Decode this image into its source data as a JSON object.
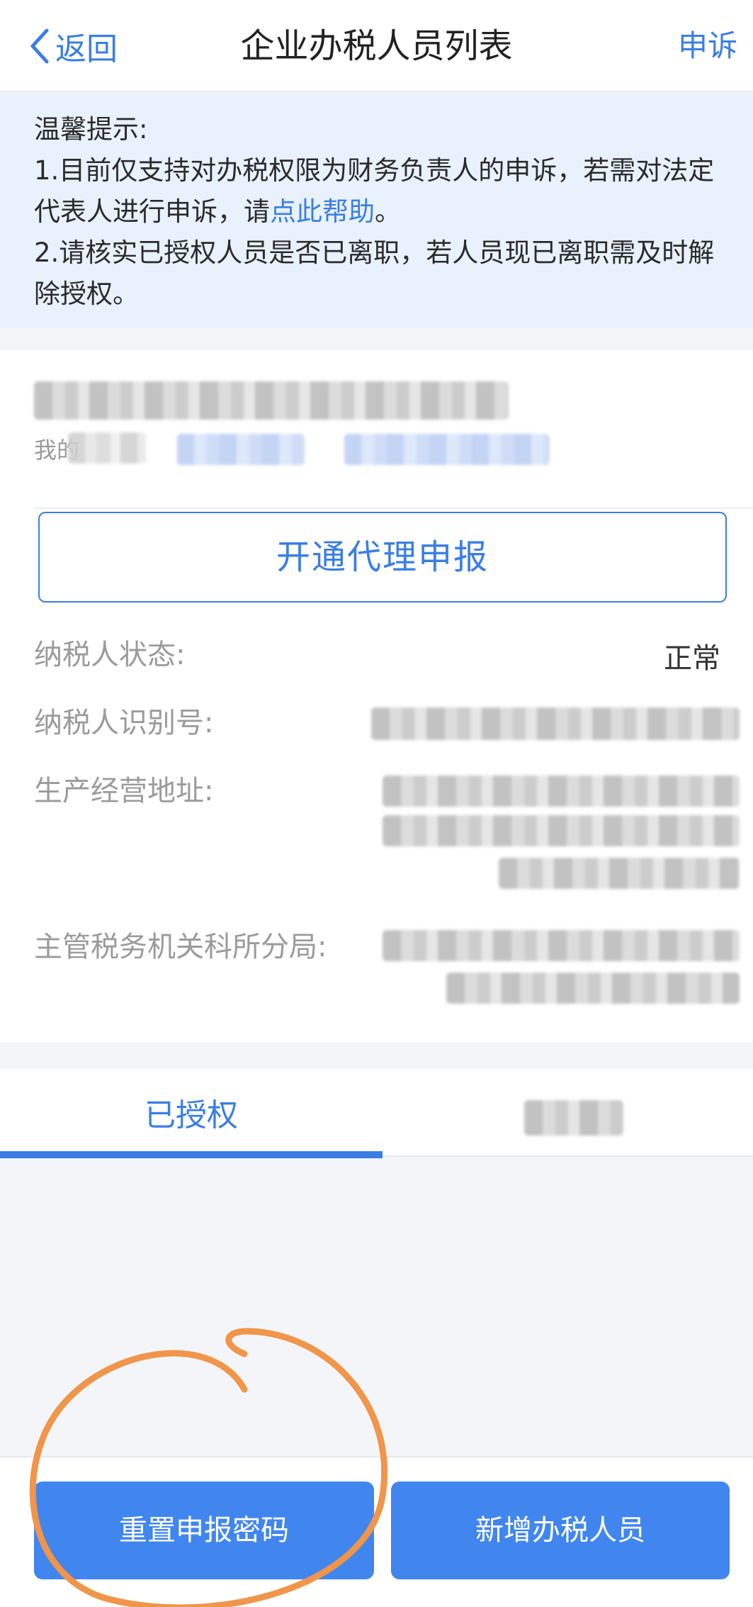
{
  "nav": {
    "back_label": "返回",
    "title": "企业办税人员列表",
    "appeal_label": "申诉"
  },
  "notice": {
    "heading": "温馨提示:",
    "line1_before": "1.目前仅支持对办税权限为财务负责人的申诉，若需对法定代表人进行申诉，请",
    "line1_link": "点此帮助",
    "line1_after": "。",
    "line2": "2.请核实已授权人员是否已离职，若人员现已离职需及时解除授权。"
  },
  "company": {
    "role_prefix": "我的"
  },
  "agent_button_label": "开通代理申报",
  "info": {
    "status_label": "纳税人状态:",
    "status_value": "正常",
    "tax_id_label": "纳税人识别号:",
    "address_label": "生产经营地址:",
    "authority_label": "主管税务机关科所分局:"
  },
  "tabs": {
    "authorized": "已授权"
  },
  "actions": {
    "reset_password": "重置申报密码",
    "add_staff": "新增办税人员"
  },
  "colors": {
    "accent": "#3a7ee4",
    "button": "#4186ef",
    "notice_bg": "#e8f1fc",
    "annotation": "#f0954a"
  }
}
